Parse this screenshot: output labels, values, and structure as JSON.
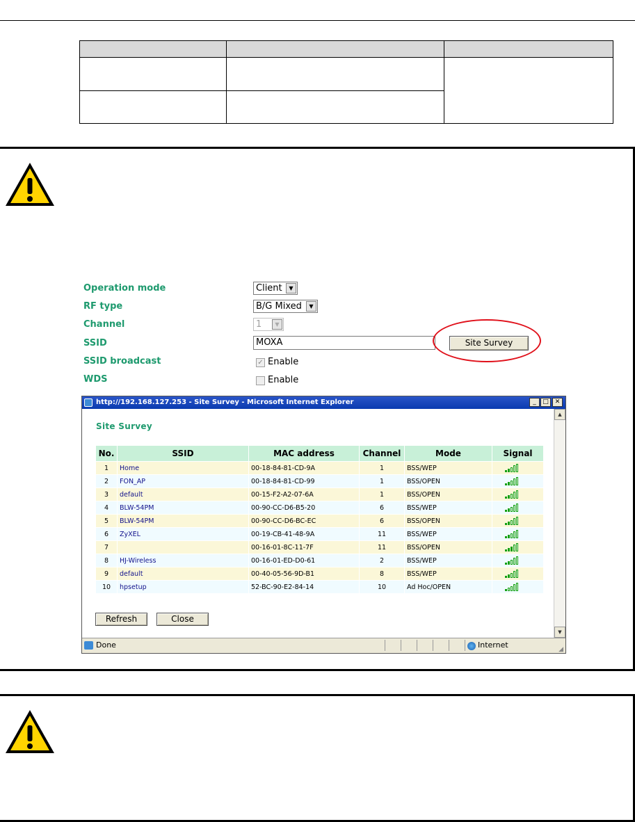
{
  "form": {
    "fields": [
      {
        "label": "Operation mode",
        "value": "Client"
      },
      {
        "label": "RF type",
        "value": "B/G Mixed"
      },
      {
        "label": "Channel",
        "value": "1"
      },
      {
        "label": "SSID",
        "value": "MOXA"
      },
      {
        "label": "SSID broadcast",
        "value": "Enable"
      },
      {
        "label": "WDS",
        "value": "Enable"
      }
    ],
    "site_survey_button": "Site Survey"
  },
  "window": {
    "title": "http://192.168.127.253 - Site Survey - Microsoft Internet Explorer",
    "heading": "Site Survey",
    "columns": [
      "No.",
      "SSID",
      "MAC address",
      "Channel",
      "Mode",
      "Signal"
    ],
    "rows": [
      {
        "no": "1",
        "ssid": "Home",
        "mac": "00-18-84-81-CD-9A",
        "channel": "1",
        "mode": "BSS/WEP",
        "signal": 2
      },
      {
        "no": "2",
        "ssid": "FON_AP",
        "mac": "00-18-84-81-CD-99",
        "channel": "1",
        "mode": "BSS/OPEN",
        "signal": 2
      },
      {
        "no": "3",
        "ssid": "default",
        "mac": "00-15-F2-A2-07-6A",
        "channel": "1",
        "mode": "BSS/OPEN",
        "signal": 2
      },
      {
        "no": "4",
        "ssid": "BLW-54PM",
        "mac": "00-90-CC-D6-B5-20",
        "channel": "6",
        "mode": "BSS/WEP",
        "signal": 2
      },
      {
        "no": "5",
        "ssid": "BLW-54PM",
        "mac": "00-90-CC-D6-BC-EC",
        "channel": "6",
        "mode": "BSS/OPEN",
        "signal": 2
      },
      {
        "no": "6",
        "ssid": "ZyXEL",
        "mac": "00-19-CB-41-48-9A",
        "channel": "11",
        "mode": "BSS/WEP",
        "signal": 2
      },
      {
        "no": "7",
        "ssid": "",
        "mac": "00-16-01-8C-11-7F",
        "channel": "11",
        "mode": "BSS/OPEN",
        "signal": 3
      },
      {
        "no": "8",
        "ssid": "HJ-Wireless",
        "mac": "00-16-01-ED-D0-61",
        "channel": "2",
        "mode": "BSS/WEP",
        "signal": 2
      },
      {
        "no": "9",
        "ssid": "default",
        "mac": "00-40-05-56-9D-B1",
        "channel": "8",
        "mode": "BSS/WEP",
        "signal": 2
      },
      {
        "no": "10",
        "ssid": "hpsetup",
        "mac": "52-BC-90-E2-84-14",
        "channel": "10",
        "mode": "Ad Hoc/OPEN",
        "signal": 1
      }
    ],
    "refresh_label": "Refresh",
    "close_label": "Close",
    "status_text": "Done",
    "zone_text": "Internet"
  }
}
